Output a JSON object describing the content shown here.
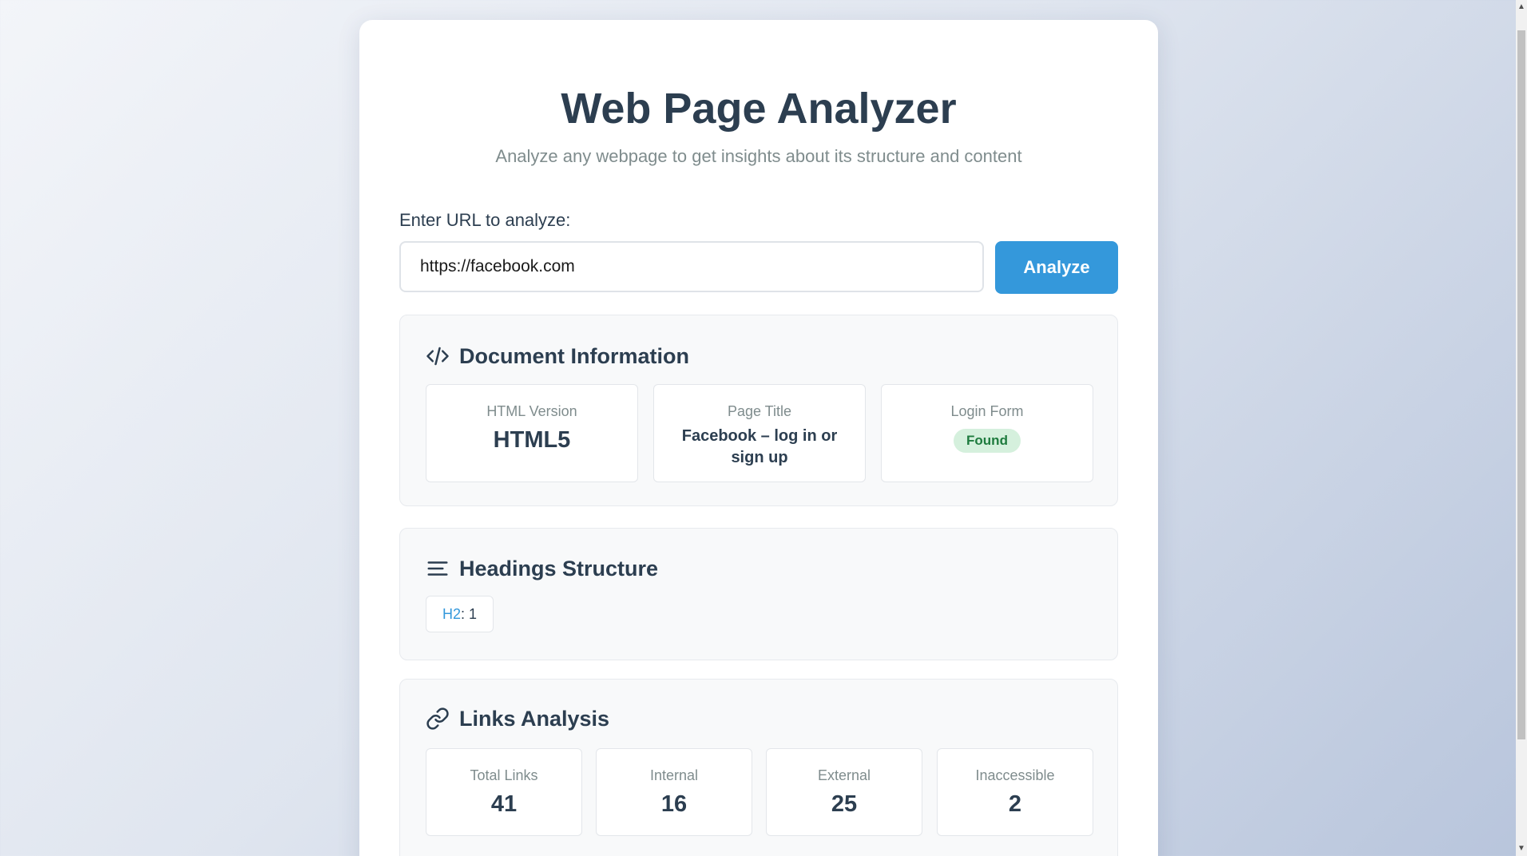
{
  "app": {
    "title": "Web Page Analyzer",
    "subtitle": "Analyze any webpage to get insights about its structure and content"
  },
  "form": {
    "label": "Enter URL to analyze:",
    "url_value": "https://facebook.com",
    "button_label": "Analyze"
  },
  "document_info": {
    "title": "Document Information",
    "icon": "code-icon",
    "html_version": {
      "label": "HTML Version",
      "value": "HTML5"
    },
    "page_title": {
      "label": "Page Title",
      "value": "Facebook – log in or sign up"
    },
    "login_form": {
      "label": "Login Form",
      "value": "Found"
    }
  },
  "headings": {
    "title": "Headings Structure",
    "icon": "align-left-icon",
    "items": [
      {
        "tag": "H2",
        "count": "1"
      }
    ]
  },
  "links": {
    "title": "Links Analysis",
    "icon": "link-icon",
    "stats": [
      {
        "label": "Total Links",
        "value": "41"
      },
      {
        "label": "Internal",
        "value": "16"
      },
      {
        "label": "External",
        "value": "25"
      },
      {
        "label": "Inaccessible",
        "value": "2"
      }
    ]
  },
  "colors": {
    "accent": "#3498db",
    "text": "#2c3e50",
    "muted": "#7f8c8d",
    "success_bg": "#d5f0dd",
    "success_text": "#1e7b3e"
  }
}
